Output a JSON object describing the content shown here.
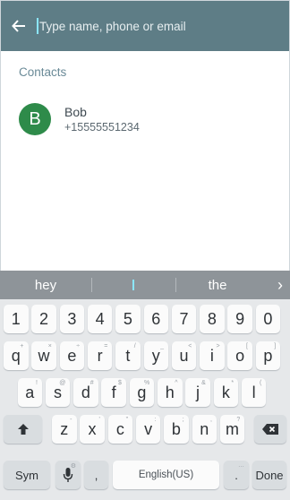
{
  "header": {
    "search_placeholder": "Type name, phone or email"
  },
  "contacts": {
    "section_title": "Contacts",
    "items": [
      {
        "initial": "B",
        "name": "Bob",
        "phone": "+15555551234"
      }
    ]
  },
  "keyboard": {
    "suggestions": [
      "hey",
      "",
      "the"
    ],
    "number_row": [
      "1",
      "2",
      "3",
      "4",
      "5",
      "6",
      "7",
      "8",
      "9",
      "0"
    ],
    "row1": [
      "q",
      "w",
      "e",
      "r",
      "t",
      "y",
      "u",
      "i",
      "o",
      "p"
    ],
    "row1_hints": [
      "+",
      "×",
      "÷",
      "=",
      "/",
      "_",
      "<",
      ">",
      "[",
      "]"
    ],
    "row2": [
      "a",
      "s",
      "d",
      "f",
      "g",
      "h",
      "j",
      "k",
      "l"
    ],
    "row2_hints": [
      "!",
      "@",
      "#",
      "$",
      "%",
      "^",
      "&",
      "*",
      "("
    ],
    "row3": [
      "z",
      "x",
      "c",
      "v",
      "b",
      "n",
      "m"
    ],
    "row3_hints": [
      "-",
      "'",
      "\"",
      ":",
      ";",
      ",",
      "?"
    ],
    "sym_label": "Sym",
    "comma_label": ",",
    "space_label": "English(US)",
    "period_label": ".",
    "done_label": "Done",
    "mic_hint": "⚙"
  }
}
